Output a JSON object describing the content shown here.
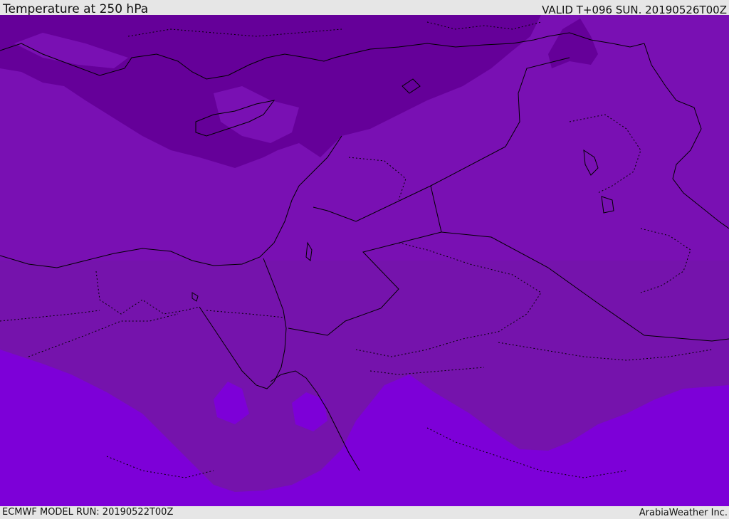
{
  "header": {
    "title": "Temperature at 250 hPa",
    "valid": "VALID T+096 SUN. 20190526T00Z"
  },
  "footer": {
    "model_run": "ECMWF MODEL RUN: 20190522T00Z",
    "credit": "ArabiaWeather Inc."
  },
  "map": {
    "colors": {
      "cold": "#650099",
      "mid": "#7910b3",
      "lower": "#7513ac",
      "warm": "#7d00d8",
      "border": "#000000"
    }
  }
}
